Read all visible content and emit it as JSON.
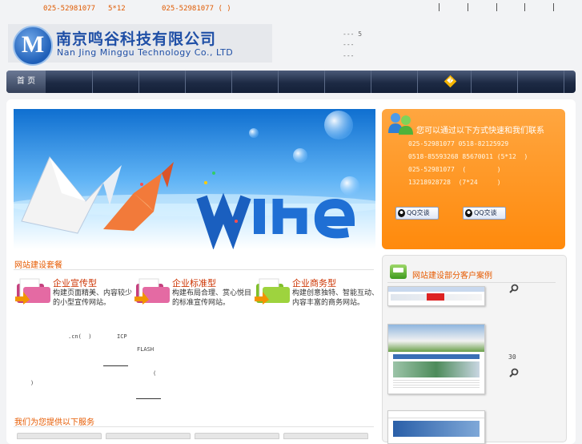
{
  "topbar": {
    "phone1": "025-52981077",
    "text2": "5*12",
    "phone2": "025-52981077 (  )"
  },
  "logo": {
    "mark": "M",
    "name_cn": "南京鸣谷科技有限公司",
    "name_en": "Nan Jing Minggu Technology Co., LTD"
  },
  "header_lines": [
    "--- 5",
    "---",
    "---"
  ],
  "nav": {
    "home": "首  页",
    "diamond": "�"
  },
  "contact": {
    "title": "您可以通过以下方式快速和我们联系",
    "lines": [
      "025-52981077 0518-82125929",
      "0518-85593268 85670011 (5*12  )",
      "025-52981077  (        )",
      "13218928728  (7*24     )"
    ],
    "qq1": "QQ交谈",
    "qq2": "QQ交谈"
  },
  "packages": {
    "section_title": "网站建设套餐",
    "items": [
      {
        "title": "企业宣传型",
        "desc_line1": "构建页面精美、内容较少",
        "desc_line2": "的小型宣传网站。"
      },
      {
        "title": "企业标准型",
        "desc_line1": "构建布局合理、赏心悦目",
        "desc_line2": "的标准宣传网站。"
      },
      {
        "title": "企业商务型",
        "desc_line1": "构建创意独特、智能互动、",
        "desc_line2": "内容丰富的商务网站。"
      }
    ]
  },
  "fragments": {
    "f1": ".cn(  )",
    "f2": "ICP",
    "f3": "FLASH",
    "f4": "(",
    "f5": ")"
  },
  "services": {
    "section_title": "我们为您提供以下服务"
  },
  "cases": {
    "section_title": "网站建设部分客户案例",
    "count": "30"
  },
  "icons": {
    "qq": "qq-penguin-icon",
    "contact": "msn-people-icon",
    "zoom": "magnifier-icon",
    "case": "monitor-icon"
  },
  "colors": {
    "accent": "#e65a00",
    "contact_bg": "#ff8a0c",
    "nav_bg": "#1d2a44",
    "brand_blue": "#1f4fa6"
  }
}
